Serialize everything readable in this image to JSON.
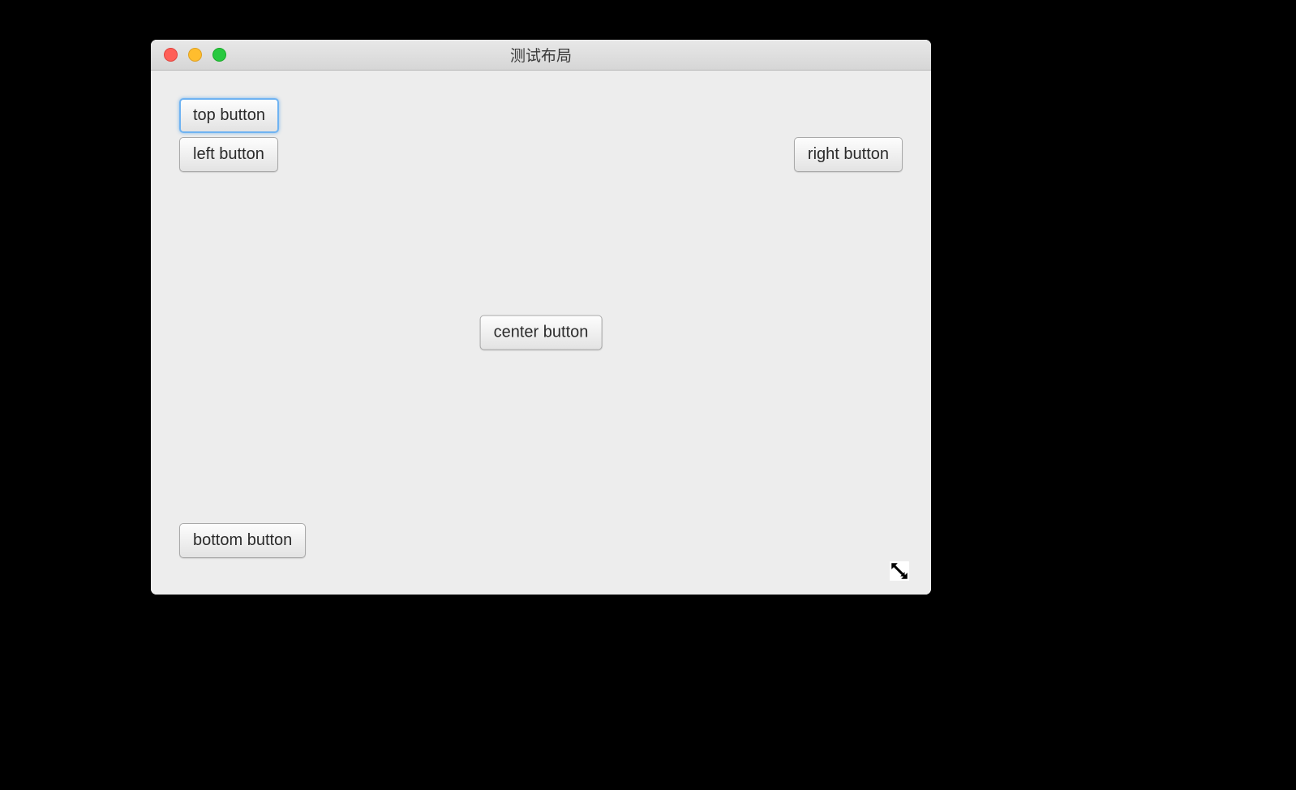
{
  "window": {
    "title": "测试布局"
  },
  "buttons": {
    "top": "top button",
    "left": "left button",
    "right": "right button",
    "center": "center button",
    "bottom": "bottom button"
  }
}
